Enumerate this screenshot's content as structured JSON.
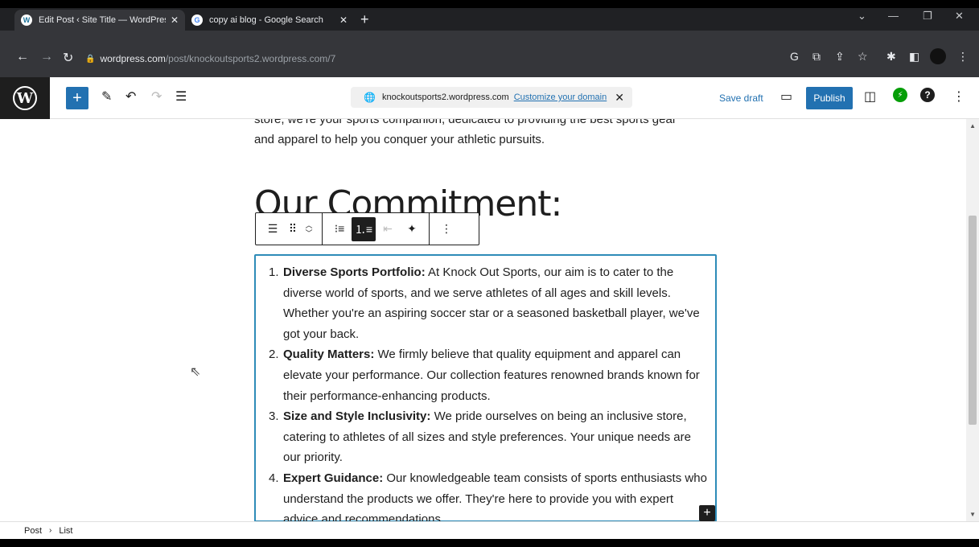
{
  "browser": {
    "tabs": [
      {
        "title": "Edit Post ‹ Site Title — WordPres",
        "favicon": "wordpress-icon",
        "active": true
      },
      {
        "title": "copy ai blog - Google Search",
        "favicon": "google-icon",
        "active": false
      }
    ],
    "url_host": "wordpress.com",
    "url_path": "/post/knockoutsports2.wordpress.com/7"
  },
  "editor": {
    "domain": "knockoutsports2.wordpress.com",
    "customize_link": "Customize your domain",
    "save_draft": "Save draft",
    "publish": "Publish"
  },
  "content": {
    "intro_line1": "store, we're your sports companion, dedicated to providing the best sports gear",
    "intro_line2": "and apparel to help you conquer your athletic pursuits.",
    "heading": "Our Commitment:",
    "list": [
      {
        "num": "1.",
        "title": "Diverse Sports Portfolio:",
        "text": " At Knock Out Sports, our aim is to cater to the diverse world of sports, and we serve athletes of all ages and skill levels. Whether you're an aspiring soccer star or a seasoned basketball player, we've got your back."
      },
      {
        "num": "2.",
        "title": "Quality Matters:",
        "text": " We firmly believe that quality equipment and apparel can elevate your performance. Our collection features renowned brands known for their performance-enhancing products."
      },
      {
        "num": "3.",
        "title": "Size and Style Inclusivity:",
        "text": " We pride ourselves on being an inclusive store, catering to athletes of all sizes and style preferences. Your unique needs are our priority."
      },
      {
        "num": "4.",
        "title": "Expert Guidance:",
        "text": " Our knowledgeable team consists of sports enthusiasts who understand the products we offer. They're here to provide you with expert advice and recommendations."
      }
    ]
  },
  "breadcrumb": {
    "item1": "Post",
    "item2": "List"
  },
  "colors": {
    "accent": "#2271b1",
    "block_border": "#2d8bb8",
    "jetpack": "#069e08"
  }
}
